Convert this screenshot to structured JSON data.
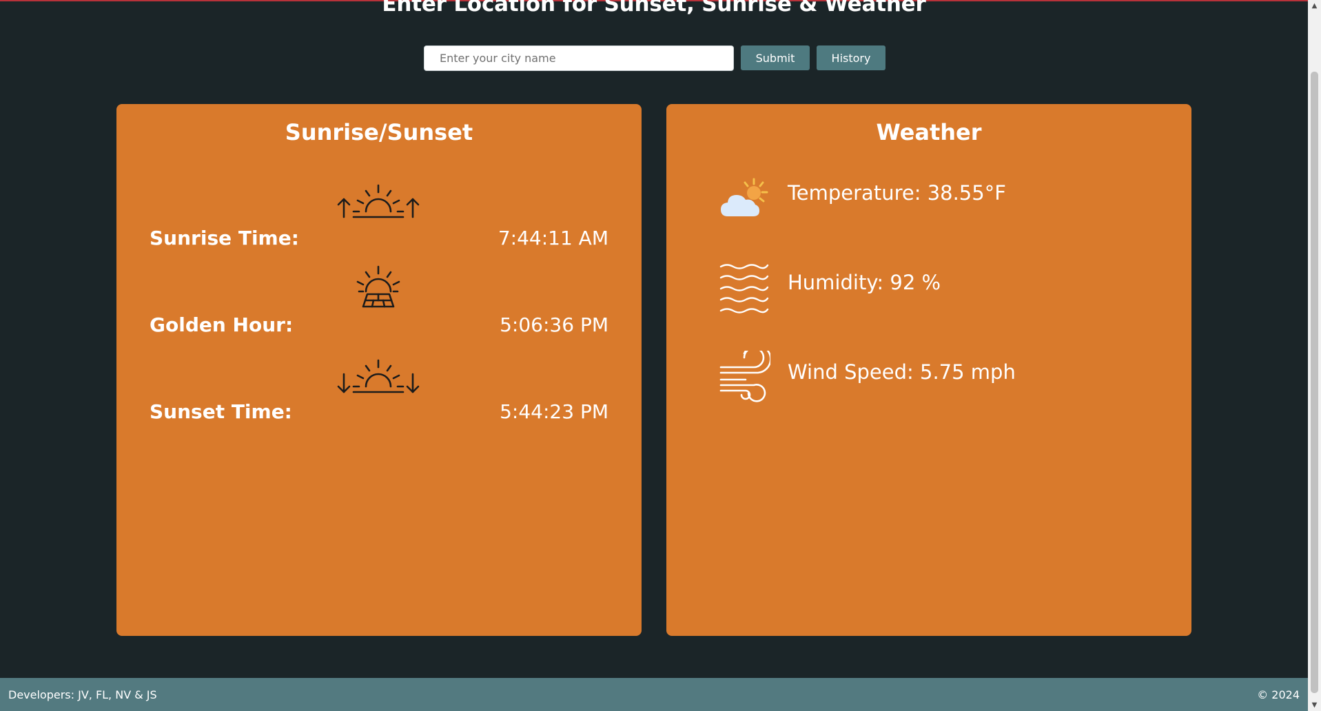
{
  "header": {
    "title": "Enter Location for Sunset, Sunrise & Weather"
  },
  "search": {
    "placeholder": "Enter your city name",
    "value": "",
    "submit_label": "Submit",
    "history_label": "History"
  },
  "sun_card": {
    "title": "Sunrise/Sunset",
    "rows": [
      {
        "icon": "sunrise-icon",
        "label": "Sunrise Time:",
        "value": "7:44:11 AM"
      },
      {
        "icon": "golden-hour-icon",
        "label": "Golden Hour:",
        "value": "5:06:36 PM"
      },
      {
        "icon": "sunset-icon",
        "label": "Sunset Time:",
        "value": "5:44:23 PM"
      }
    ]
  },
  "weather_card": {
    "title": "Weather",
    "rows": [
      {
        "icon": "partly-cloudy-icon",
        "text": "Temperature: 38.55°F"
      },
      {
        "icon": "humidity-waves-icon",
        "text": "Humidity: 92 %"
      },
      {
        "icon": "wind-icon",
        "text": "Wind Speed: 5.75 mph"
      }
    ]
  },
  "footer": {
    "developers": "Developers: JV, FL, NV & JS",
    "copyright": "© 2024"
  },
  "colors": {
    "background": "#1b2528",
    "card": "#d97a2c",
    "button": "#4e7a80",
    "footer": "#537a80",
    "top_line": "#b8323a"
  }
}
